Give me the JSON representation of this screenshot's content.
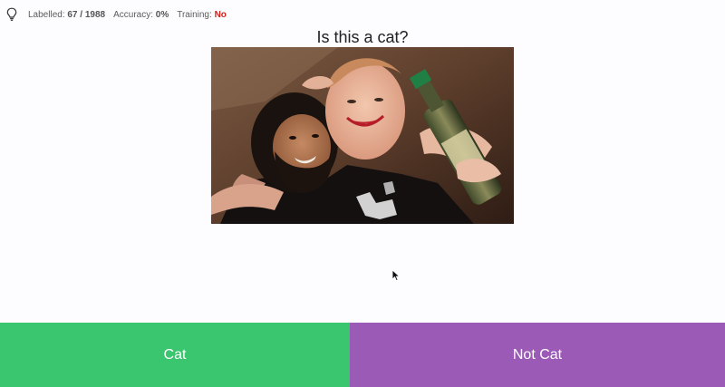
{
  "status": {
    "labelled_label": "Labelled:",
    "labelled_value": "67 / 1988",
    "accuracy_label": "Accuracy:",
    "accuracy_value": "0%",
    "training_label": "Training:",
    "training_value": "No"
  },
  "question": "Is this a cat?",
  "image": {
    "subject": "two men posing together, one holding a bottle"
  },
  "buttons": {
    "cat_label": "Cat",
    "not_cat_label": "Not Cat"
  },
  "colors": {
    "cat_button": "#3ac56f",
    "not_cat_button": "#9b5ab5",
    "training_no": "#d0211d"
  },
  "icons": {
    "status": "lightbulb-icon",
    "pointer": "mouse-cursor-icon"
  }
}
